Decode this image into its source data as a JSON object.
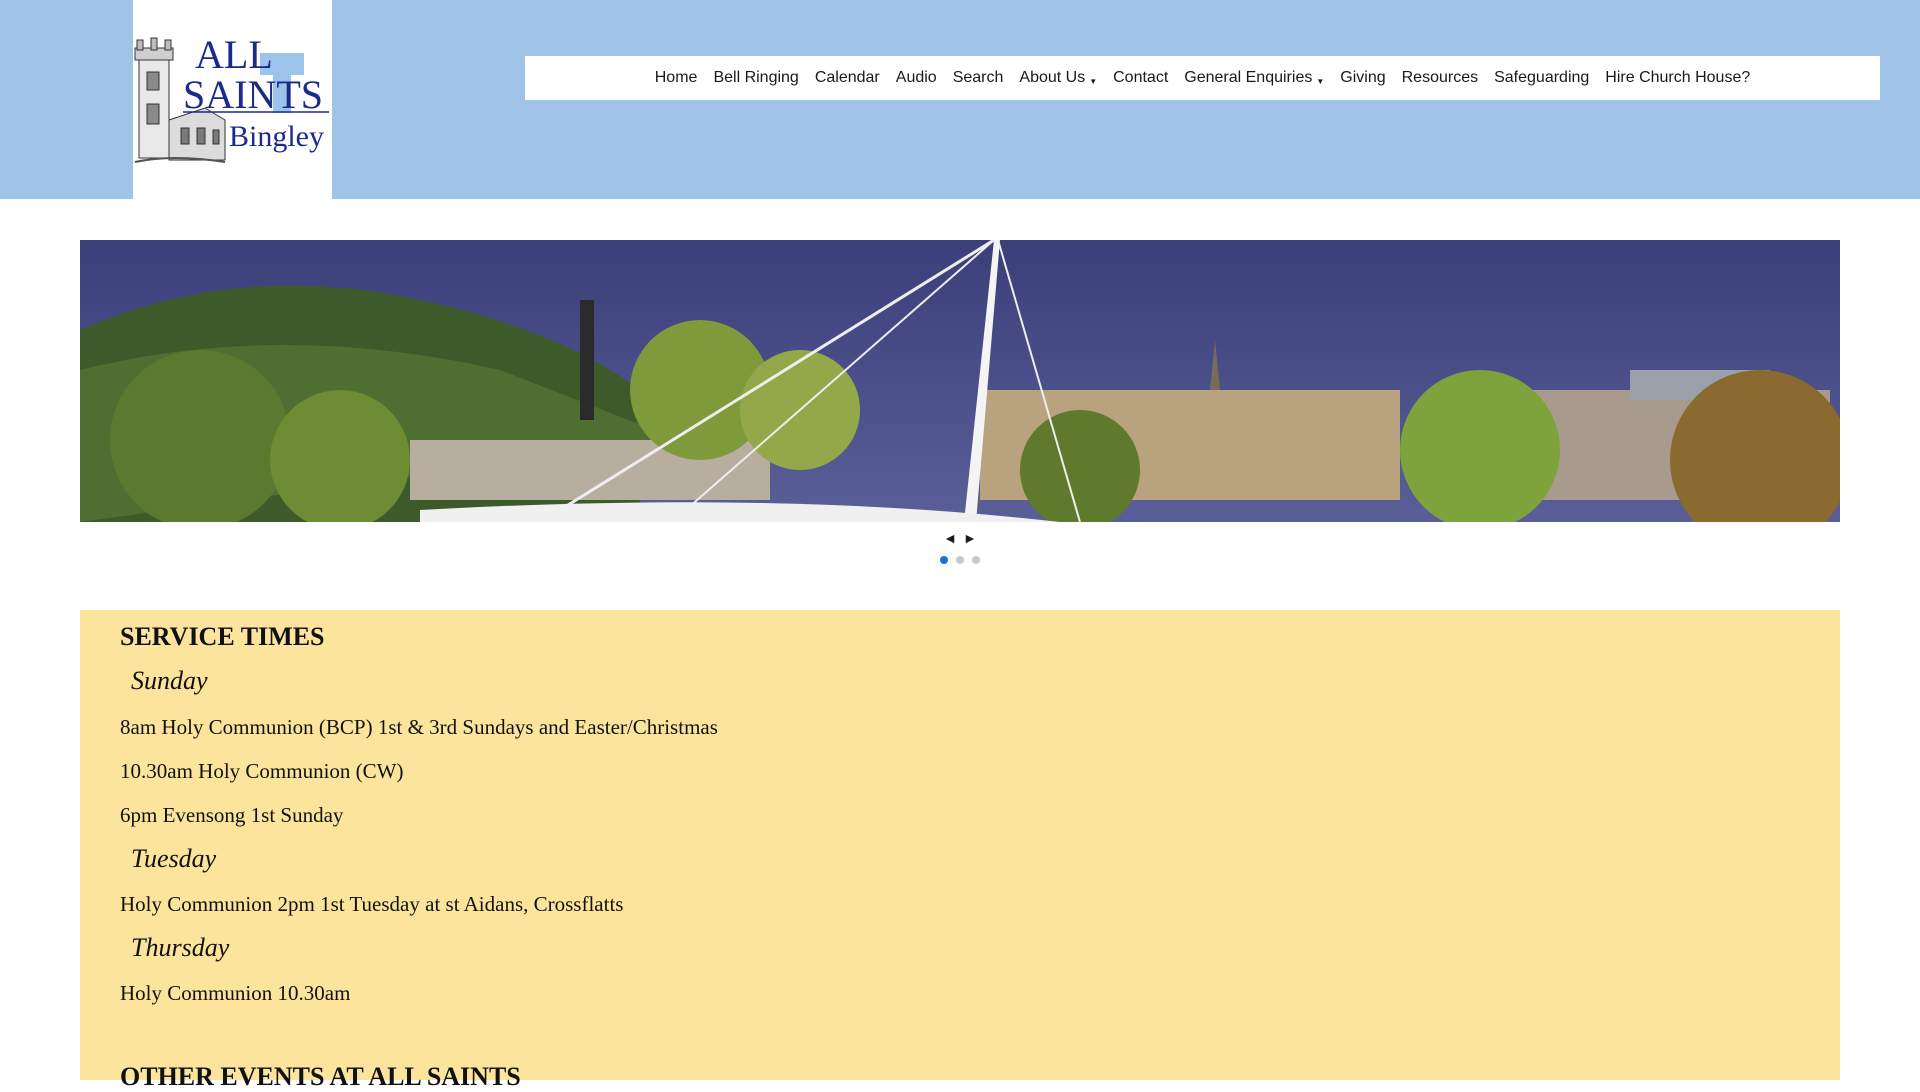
{
  "logo": {
    "line1": "ALL",
    "line2": "SAINTS",
    "line3": "Bingley"
  },
  "nav": [
    {
      "label": "Home",
      "dropdown": false
    },
    {
      "label": "Bell Ringing",
      "dropdown": false
    },
    {
      "label": "Calendar",
      "dropdown": false
    },
    {
      "label": "Audio",
      "dropdown": false
    },
    {
      "label": "Search",
      "dropdown": false
    },
    {
      "label": "About Us",
      "dropdown": true
    },
    {
      "label": "Contact",
      "dropdown": false
    },
    {
      "label": "General Enquiries",
      "dropdown": true
    },
    {
      "label": "Giving",
      "dropdown": false
    },
    {
      "label": "Resources",
      "dropdown": false
    },
    {
      "label": "Safeguarding",
      "dropdown": false
    },
    {
      "label": "Hire Church House?",
      "dropdown": false
    }
  ],
  "slider": {
    "prev": "◄",
    "next": "►",
    "slide_count": 3,
    "active_slide": 1
  },
  "service_times": {
    "heading": "SERVICE TIMES",
    "sunday": "Sunday",
    "sunday_1": "8am Holy Communion (BCP) 1st & 3rd Sundays and Easter/Christmas",
    "sunday_2": "10.30am Holy Communion (CW)",
    "sunday_3": "6pm Evensong 1st Sunday",
    "tuesday": "Tuesday",
    "tuesday_1": "Holy Communion 2pm 1st Tuesday at st Aidans, Crossflatts",
    "thursday": "Thursday",
    "thursday_1": "Holy Communion 10.30am"
  },
  "other_events": {
    "heading": "OTHER EVENTS AT ALL SAINTS"
  },
  "colors": {
    "header_bg": "#a0c4e8",
    "content_bg": "#fde49c",
    "logo_blue": "#1c2a8c",
    "dot_active": "#1a73d8"
  }
}
